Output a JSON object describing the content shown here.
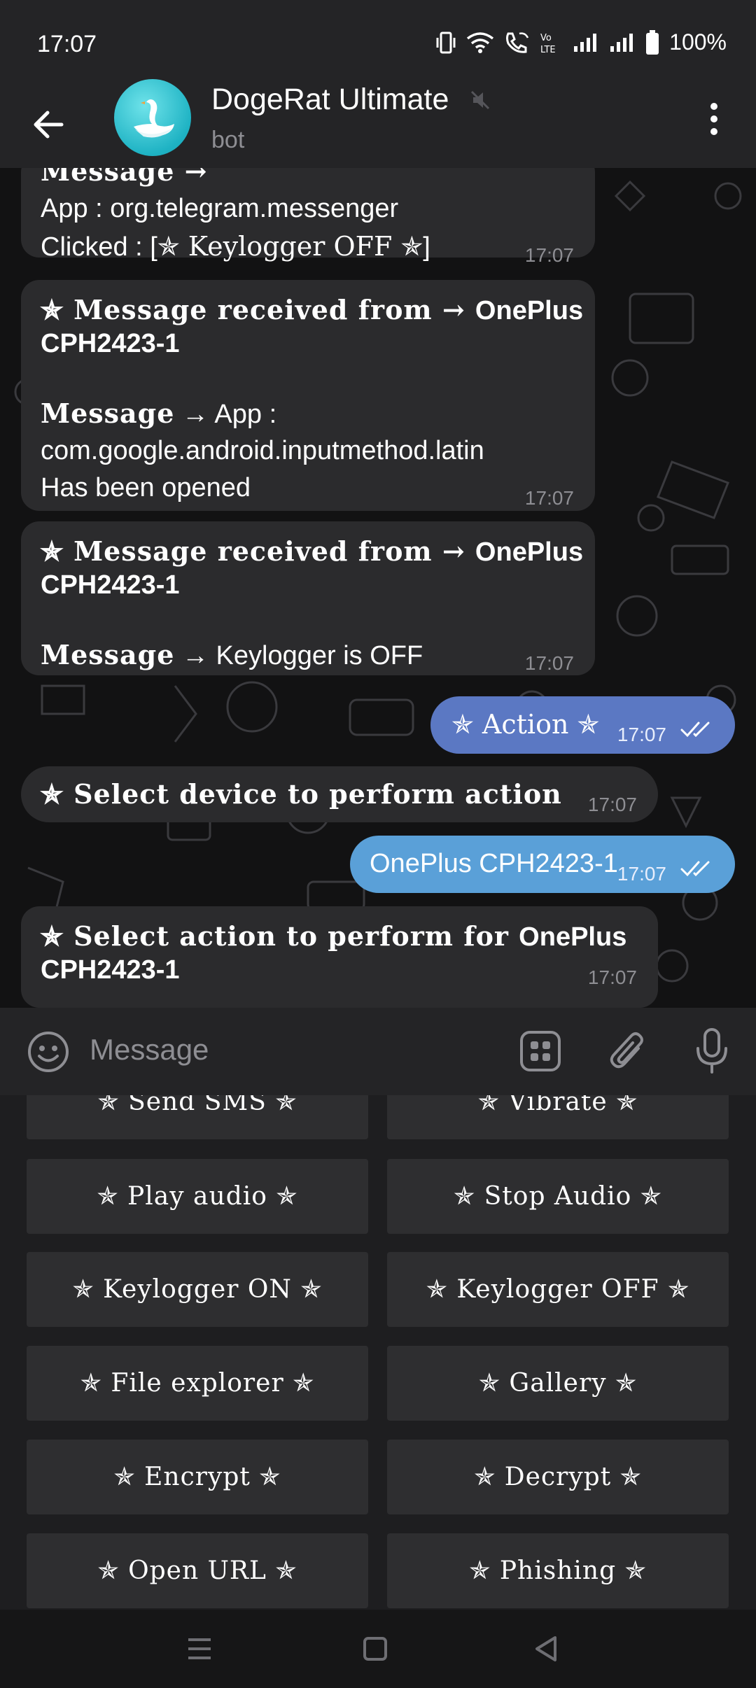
{
  "status": {
    "time": "17:07",
    "battery": "100%"
  },
  "header": {
    "title": "DogeRat Ultimate",
    "subtitle": "bot"
  },
  "messages": {
    "m1_line1": "Message →",
    "m1_line2": "App : org.telegram.messenger",
    "m1_line3a": "Clicked : [",
    "m1_line3b": "✯ Keylogger OFF ✯",
    "m1_line3c": "]",
    "m1_time": "17:07",
    "m2_head": "✯ Message received from → ",
    "m2_head2": "OnePlus",
    "m2_head3": "CPH2423-1",
    "m2_label": "Message",
    "m2_body1": " → App :",
    "m2_body2": "com.google.android.inputmethod.latin",
    "m2_body3": "Has been opened",
    "m2_time": "17:07",
    "m3_head": "✯ Message received from → ",
    "m3_head2": "OnePlus",
    "m3_head3": "CPH2423-1",
    "m3_label": "Message",
    "m3_body": " → Keylogger is OFF",
    "m3_time": "17:07",
    "m4_text": "✯ Action ✯",
    "m4_time": "17:07",
    "m5_text": "✯ Select device to perform action",
    "m5_time": "17:07",
    "m6_text": "OnePlus CPH2423-1",
    "m6_time": "17:07",
    "m7_head": "✯ Select action to perform for ",
    "m7_head2": "OnePlus",
    "m7_head3": "CPH2423-1",
    "m7_time": "17:07"
  },
  "input": {
    "placeholder": "Message"
  },
  "keyboard": {
    "buttons": [
      "✯ Send SMS ✯",
      "✯ Vibrate ✯",
      "✯ Play audio ✯",
      "✯ Stop Audio ✯",
      "✯ Keylogger ON ✯",
      "✯ Keylogger OFF ✯",
      "✯ File explorer ✯",
      "✯ Gallery ✯",
      "✯ Encrypt ✯",
      "✯ Decrypt ✯",
      "✯ Open URL ✯",
      "✯ Phishing ✯"
    ]
  },
  "colors": {
    "outgoing_action": "#5b78c3",
    "outgoing_device": "#5aa0d8",
    "incoming": "#2b2b2d",
    "avatar": "#1fb3c4"
  },
  "icons": [
    "vibrate-icon",
    "wifi-icon",
    "wifi-call-icon",
    "volte-icon",
    "signal-icon",
    "battery-icon",
    "back-arrow-icon",
    "swan-avatar-icon",
    "mute-icon",
    "more-vert-icon",
    "emoji-icon",
    "bot-commands-icon",
    "attach-icon",
    "mic-icon",
    "double-check-icon",
    "nav-menu-icon",
    "nav-home-icon",
    "nav-back-icon"
  ]
}
